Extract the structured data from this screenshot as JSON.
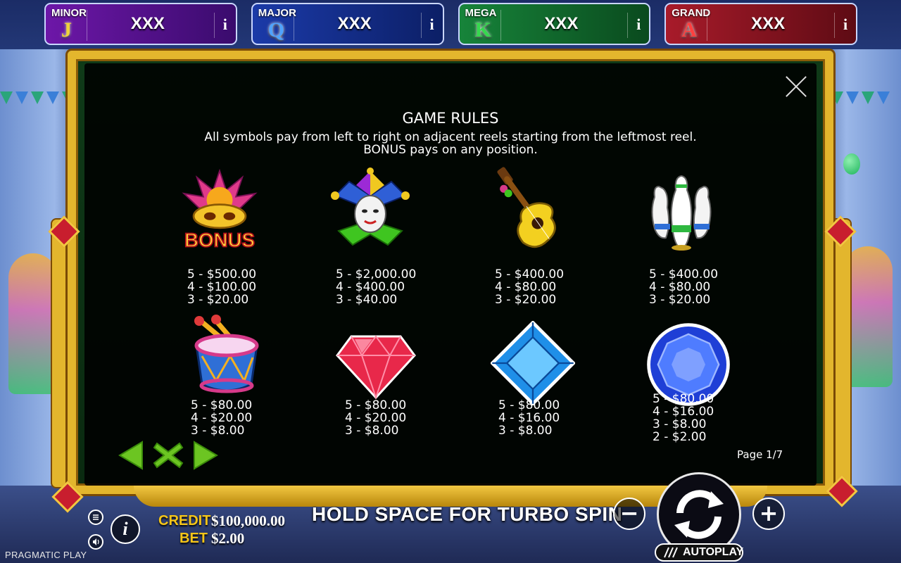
{
  "jackpots": [
    {
      "name": "MINOR",
      "letter": "J",
      "value": "XXX",
      "info": "i"
    },
    {
      "name": "MAJOR",
      "letter": "Q",
      "value": "XXX",
      "info": "i"
    },
    {
      "name": "MEGA",
      "letter": "K",
      "value": "XXX",
      "info": "i"
    },
    {
      "name": "GRAND",
      "letter": "A",
      "value": "XXX",
      "info": "i"
    }
  ],
  "rules": {
    "title": "GAME RULES",
    "line1": "All symbols pay from left to right on adjacent reels starting from the leftmost reel.",
    "line2": "BONUS pays on any position.",
    "page": "Page 1/7"
  },
  "symbols": [
    {
      "icon": "bonus-mask-icon",
      "bonus_text": "BONUS",
      "pays": [
        "5 - $500.00",
        "4 - $100.00",
        "3 - $20.00"
      ]
    },
    {
      "icon": "jester-icon",
      "pays": [
        "5 - $2,000.00",
        "4 - $400.00",
        "3 - $40.00"
      ]
    },
    {
      "icon": "guitar-icon",
      "pays": [
        "5 - $400.00",
        "4 - $80.00",
        "3 - $20.00"
      ]
    },
    {
      "icon": "bowling-pins-icon",
      "pays": [
        "5 - $400.00",
        "4 - $80.00",
        "3 - $20.00"
      ]
    },
    {
      "icon": "drum-icon",
      "pays": [
        "5 - $80.00",
        "4 - $20.00",
        "3 - $8.00"
      ]
    },
    {
      "icon": "red-gem-icon",
      "pays": [
        "5 - $80.00",
        "4 - $20.00",
        "3 - $8.00"
      ]
    },
    {
      "icon": "blue-octagon-gem-icon",
      "pays": [
        "5 - $80.00",
        "4 - $16.00",
        "3 - $8.00"
      ]
    },
    {
      "icon": "blue-round-gem-icon",
      "pays": [
        "5 - $80.00",
        "4 - $16.00",
        "3 - $8.00",
        "2 - $2.00"
      ]
    }
  ],
  "bottom_bar": {
    "credit_label": "CREDIT",
    "credit_value": "$100,000.00",
    "bet_label": "BET",
    "bet_value": "$2.00",
    "turbo_hint": "HOLD SPACE FOR TURBO SPIN",
    "minus": "−",
    "plus": "+",
    "autoplay": "AUTOPLAY",
    "info": "i",
    "brand": "PRAGMATIC PLAY"
  },
  "colors": {
    "gold_frame": "#e3b62d",
    "nav_green": "#6cc522",
    "credit_label": "#f5c518"
  }
}
